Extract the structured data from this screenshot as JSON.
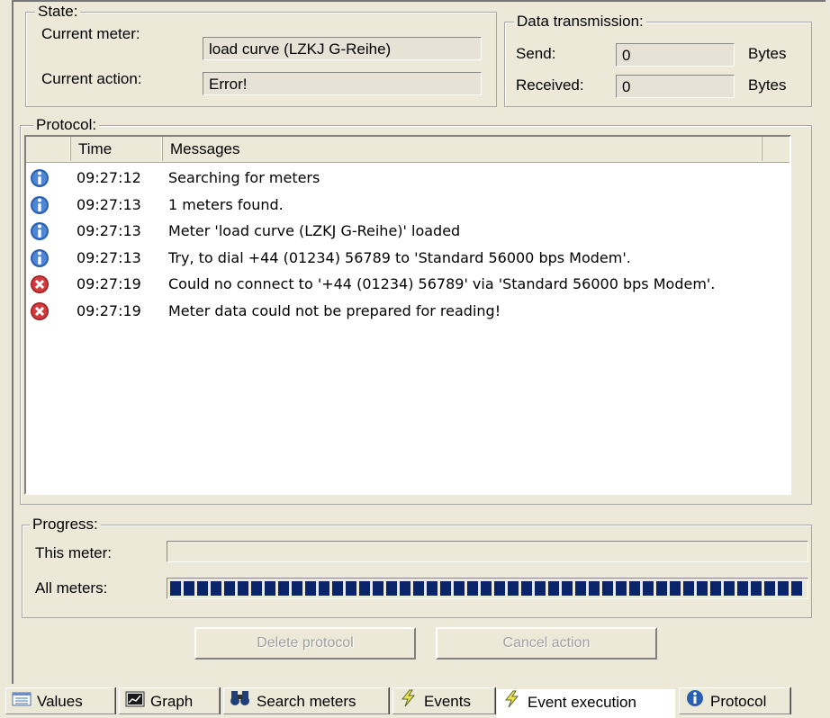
{
  "state": {
    "title": "State:",
    "current_meter_label": "Current meter:",
    "current_meter_value": "load curve (LZKJ G-Reihe)",
    "current_action_label": "Current action:",
    "current_action_value": "Error!"
  },
  "transmission": {
    "title": "Data transmission:",
    "send_label": "Send:",
    "send_value": "0",
    "send_unit": "Bytes",
    "received_label": "Received:",
    "received_value": "0",
    "received_unit": "Bytes"
  },
  "protocol": {
    "title": "Protocol:",
    "columns": [
      "",
      "Time",
      "Messages"
    ],
    "rows": [
      {
        "type": "info-icon",
        "time": "09:27:12",
        "message": "Searching for meters"
      },
      {
        "type": "info-icon",
        "time": "09:27:13",
        "message": "1 meters found."
      },
      {
        "type": "info-icon",
        "time": "09:27:13",
        "message": "Meter 'load curve (LZKJ G-Reihe)' loaded"
      },
      {
        "type": "info-icon",
        "time": "09:27:13",
        "message": "Try, to dial +44 (01234) 56789 to 'Standard 56000 bps Modem'."
      },
      {
        "type": "error-icon",
        "time": "09:27:19",
        "message": "Could no connect to '+44 (01234) 56789' via 'Standard 56000 bps Modem'."
      },
      {
        "type": "error-icon",
        "time": "09:27:19",
        "message": "Meter data could not be prepared for reading!"
      }
    ]
  },
  "progress": {
    "title": "Progress:",
    "this_meter_label": "This meter:",
    "this_meter_fraction": 0,
    "all_meters_label": "All meters:",
    "all_meters_fraction": 1
  },
  "buttons": {
    "delete_protocol": "Delete protocol",
    "cancel_action": "Cancel action"
  },
  "tabs": [
    {
      "label": "Values",
      "icon": "values-icon"
    },
    {
      "label": "Graph",
      "icon": "graph-icon"
    },
    {
      "label": "Search meters",
      "icon": "binoculars-icon"
    },
    {
      "label": "Events",
      "icon": "lightning-icon"
    },
    {
      "label": "Event execution",
      "icon": "lightning-icon",
      "active": true
    },
    {
      "label": "Protocol",
      "icon": "info-icon"
    }
  ],
  "colors": {
    "background": "#ece9d8",
    "progress_fill": "#0a246a",
    "info_icon": "#2b5fb0",
    "error_icon": "#c0282c"
  }
}
